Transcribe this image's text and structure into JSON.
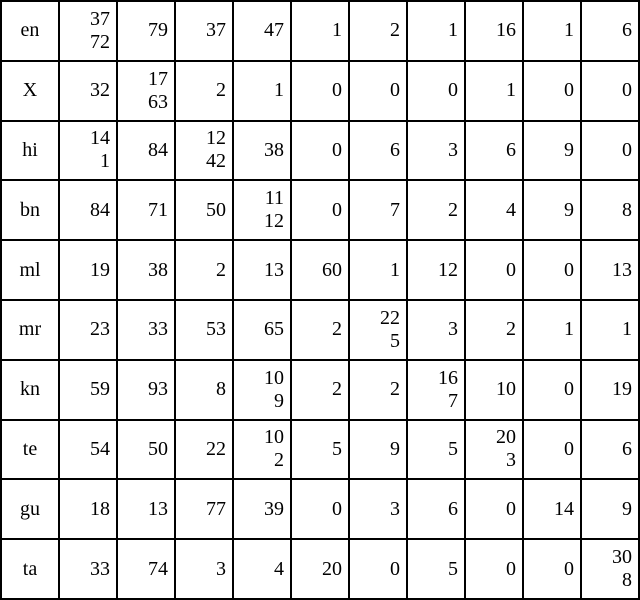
{
  "chart_data": {
    "type": "table",
    "title": "",
    "row_labels": [
      "en",
      "X",
      "hi",
      "bn",
      "ml",
      "mr",
      "kn",
      "te",
      "gu",
      "ta"
    ],
    "cells": [
      [
        "3772",
        "79",
        "37",
        "47",
        "1",
        "2",
        "1",
        "16",
        "1",
        "6"
      ],
      [
        "32",
        "1763",
        "2",
        "1",
        "0",
        "0",
        "0",
        "1",
        "0",
        "0"
      ],
      [
        "141",
        "84",
        "1242",
        "38",
        "0",
        "6",
        "3",
        "6",
        "9",
        "0"
      ],
      [
        "84",
        "71",
        "50",
        "1112",
        "0",
        "7",
        "2",
        "4",
        "9",
        "8"
      ],
      [
        "19",
        "38",
        "2",
        "13",
        "60",
        "1",
        "12",
        "0",
        "0",
        "13"
      ],
      [
        "23",
        "33",
        "53",
        "65",
        "2",
        "225",
        "3",
        "2",
        "1",
        "1"
      ],
      [
        "59",
        "93",
        "8",
        "109",
        "2",
        "2",
        "167",
        "10",
        "0",
        "19"
      ],
      [
        "54",
        "50",
        "22",
        "102",
        "5",
        "9",
        "5",
        "203",
        "0",
        "6"
      ],
      [
        "18",
        "13",
        "77",
        "39",
        "0",
        "3",
        "6",
        "0",
        "14",
        "9"
      ],
      [
        "33",
        "74",
        "3",
        "4",
        "20",
        "0",
        "5",
        "0",
        "0",
        "308"
      ]
    ]
  }
}
